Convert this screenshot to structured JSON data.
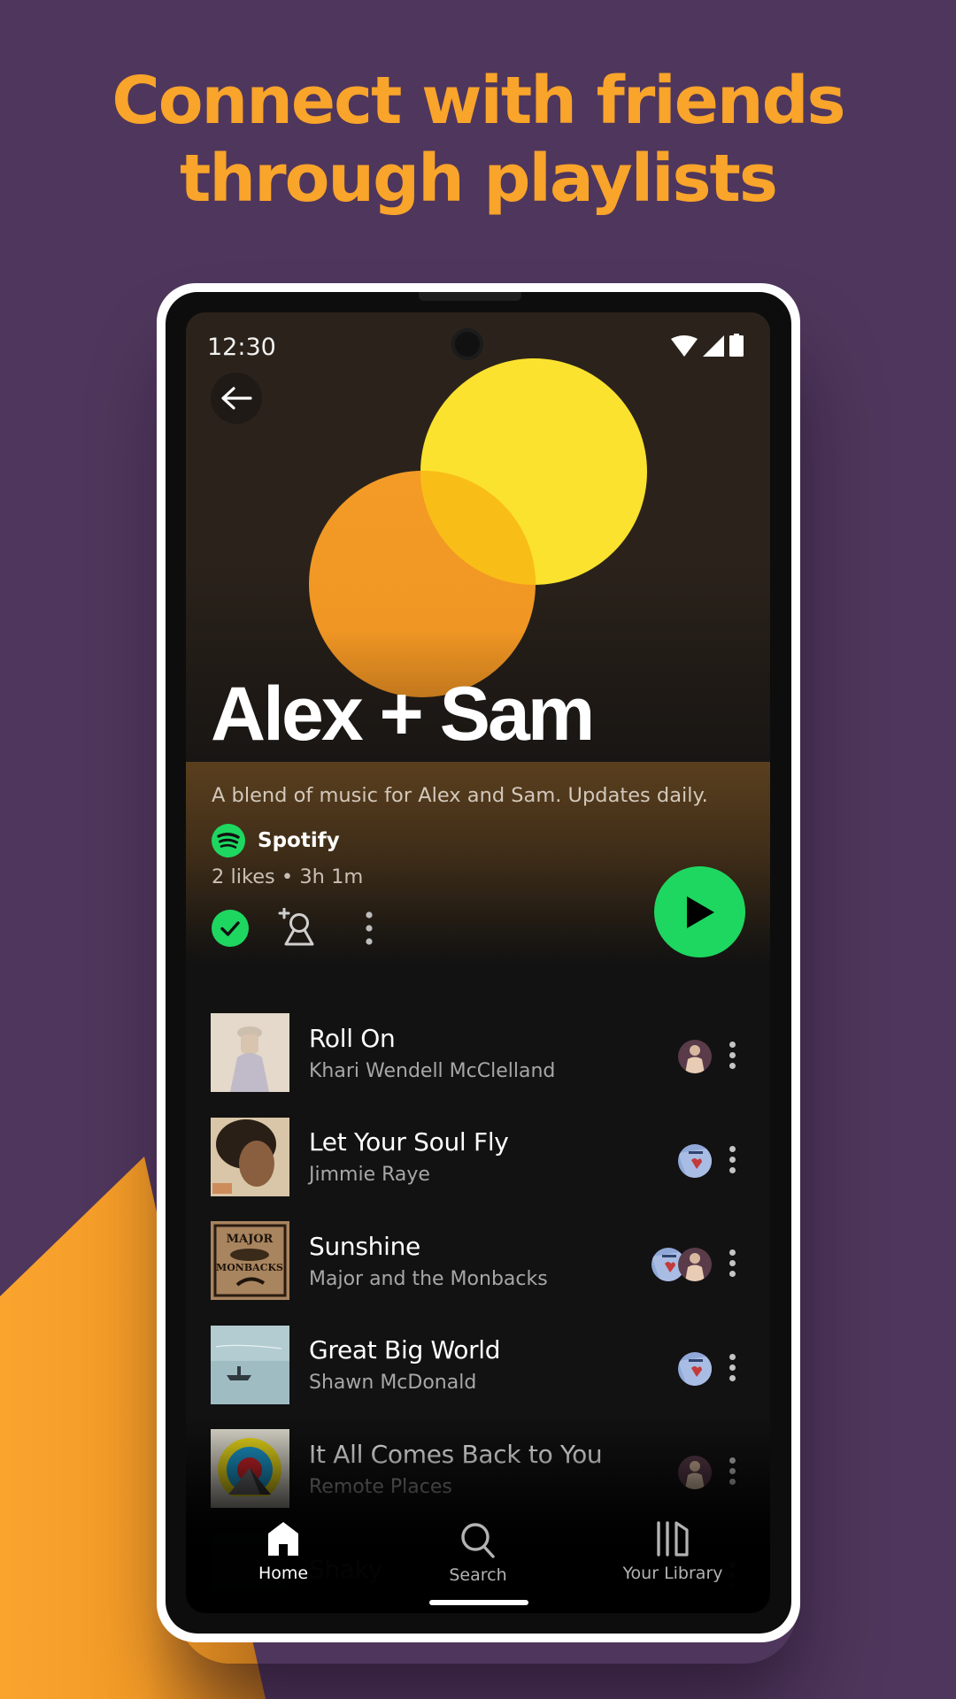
{
  "promo": {
    "headline_line1": "Connect with friends",
    "headline_line2": "through playlists",
    "colors": {
      "background": "#4f365c",
      "headline": "#f9a42a",
      "accent_shape": "#f9a42a"
    }
  },
  "status_bar": {
    "time": "12:30",
    "icons": [
      "wifi-icon",
      "signal-icon",
      "battery-icon"
    ]
  },
  "header": {
    "back_icon": "arrow-left-icon"
  },
  "playlist": {
    "title": "Alex + Sam",
    "description": "A blend of music for Alex and Sam. Updates daily.",
    "owner": "Spotify",
    "meta": "2 likes • 3h 1m",
    "cover_colors": {
      "yellow": "#fbe22e",
      "orange": "#f49b26",
      "overlap": "#f9bd18"
    },
    "liked": true,
    "accent": "#1ed760"
  },
  "actions": {
    "liked_icon": "check-circle-icon",
    "add_collaborator_icon": "add-user-icon",
    "more_icon": "more-vertical-icon",
    "play_icon": "play-icon"
  },
  "tracks": [
    {
      "title": "Roll On",
      "artist": "Khari Wendell McClelland",
      "listeners": [
        "sam"
      ]
    },
    {
      "title": "Let Your Soul Fly",
      "artist": "Jimmie Raye",
      "listeners": [
        "alex"
      ]
    },
    {
      "title": "Sunshine",
      "artist": "Major and the Monbacks",
      "listeners": [
        "alex",
        "sam"
      ]
    },
    {
      "title": "Great Big World",
      "artist": "Shawn McDonald",
      "listeners": [
        "alex"
      ]
    },
    {
      "title": "It All Comes Back to You",
      "artist": "Remote Places",
      "listeners": [
        "sam"
      ]
    },
    {
      "title": "Shaky",
      "artist": "",
      "listeners": []
    }
  ],
  "bottom_nav": {
    "items": [
      {
        "label": "Home",
        "icon": "home-icon",
        "active": true
      },
      {
        "label": "Search",
        "icon": "search-icon",
        "active": false
      },
      {
        "label": "Your Library",
        "icon": "library-icon",
        "active": false
      }
    ]
  }
}
